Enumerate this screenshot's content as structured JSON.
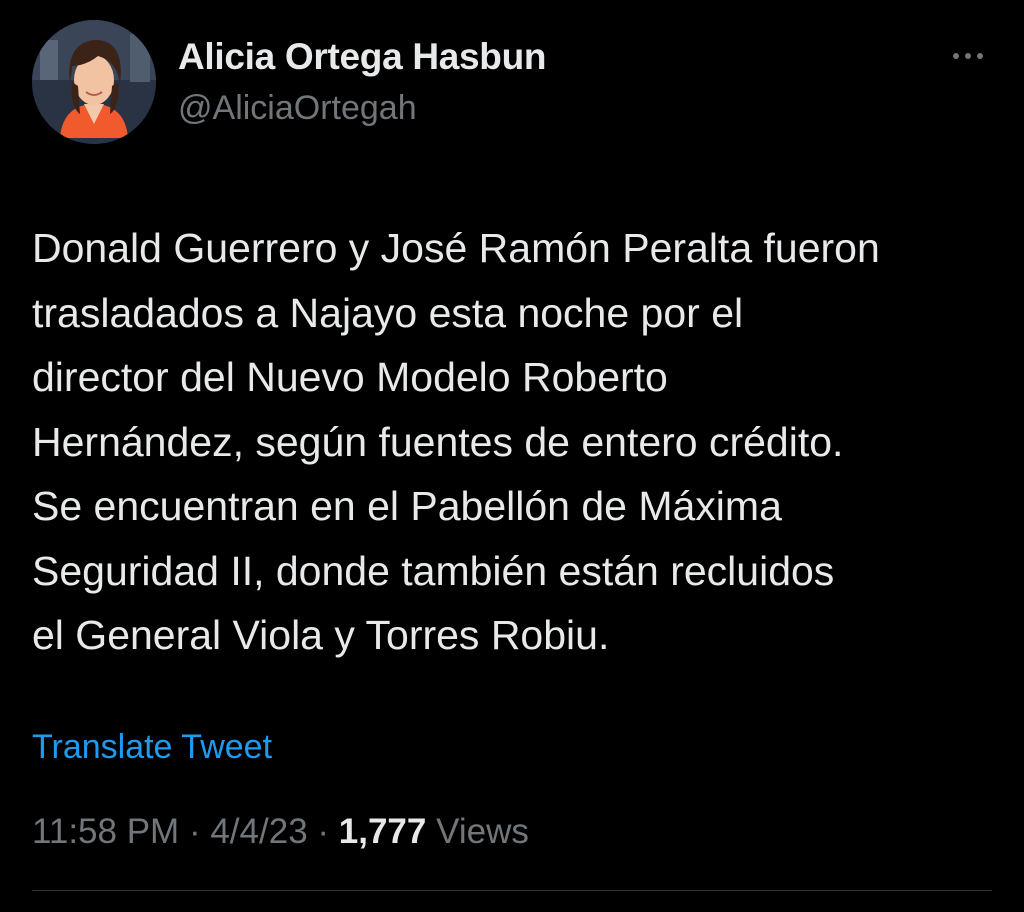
{
  "author": {
    "display_name": "Alicia Ortega Hasbun",
    "handle": "@AliciaOrtegah",
    "avatar_icon": "profile-photo"
  },
  "more_icon": "more-options-icon",
  "tweet": {
    "text": "Donald Guerrero y José Ramón Peralta fueron\ntrasladados a Najayo esta noche por el\ndirector del Nuevo Modelo Roberto\nHernández, según fuentes de entero crédito.\nSe encuentran en el Pabellón de Máxima\nSeguridad II, donde también están recluidos\nel General Viola y Torres Robiu.",
    "translate_label": "Translate Tweet",
    "time": "11:58 PM",
    "date": "4/4/23",
    "separator": "·",
    "views_count": "1,777",
    "views_label": "Views"
  },
  "colors": {
    "background": "#000000",
    "primary_text": "#e7e9ea",
    "secondary_text": "#71767b",
    "link": "#1d9bf0"
  }
}
